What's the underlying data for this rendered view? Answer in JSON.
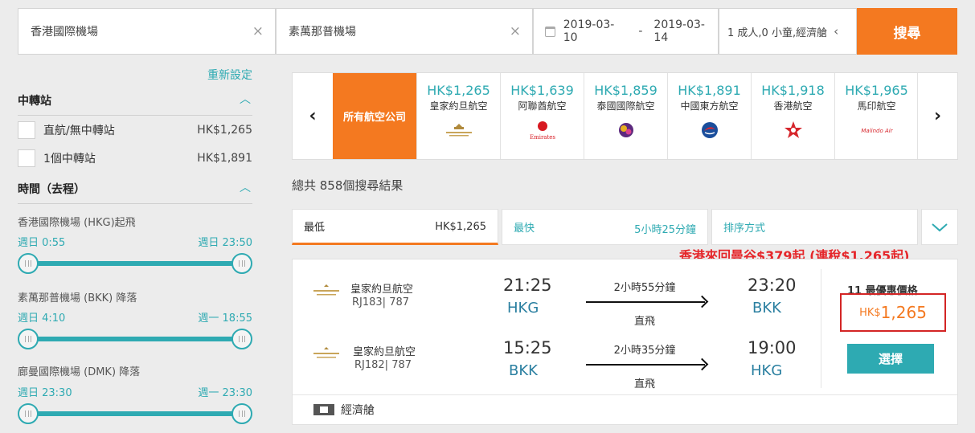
{
  "search": {
    "origin": "香港國際機場",
    "destination": "素萬那普機場",
    "date_from": "2019-03-10",
    "date_sep": "-",
    "date_to": "2019-03-14",
    "passengers": "1 成人,0 小童,經濟艙",
    "search_label": "搜尋",
    "clear_glyph": "×",
    "pax_chevron": "‹"
  },
  "sidebar": {
    "reset_label": "重新設定",
    "stops_title": "中轉站",
    "stops": [
      {
        "label": "直航/無中轉站",
        "price": "HK$1,265"
      },
      {
        "label": "1個中轉站",
        "price": "HK$1,891"
      }
    ],
    "time_title": "時間（去程）",
    "sliders": [
      {
        "label": "香港國際機場 (HKG)起飛",
        "from": "週日 0:55",
        "to": "週日 23:50"
      },
      {
        "label": "素萬那普機場 (BKK) 降落",
        "from": "週日 4:10",
        "to": "週一 18:55"
      },
      {
        "label": "廊曼國際機場 (DMK) 降落",
        "from": "週日 23:30",
        "to": "週一 23:30"
      }
    ]
  },
  "carousel": {
    "all_label": "所有航空公司",
    "items": [
      {
        "price": "HK$1,265",
        "name": "皇家約旦航空",
        "logo": "royal-jordanian-logo"
      },
      {
        "price": "HK$1,639",
        "name": "阿聯酋航空",
        "logo": "emirates-logo"
      },
      {
        "price": "HK$1,859",
        "name": "泰國國際航空",
        "logo": "thai-airways-logo"
      },
      {
        "price": "HK$1,891",
        "name": "中國東方航空",
        "logo": "china-eastern-logo"
      },
      {
        "price": "HK$1,918",
        "name": "香港航空",
        "logo": "hong-kong-airlines-logo"
      },
      {
        "price": "HK$1,965",
        "name": "馬印航空",
        "logo": "malindo-air-logo"
      }
    ],
    "emirates_logo_text": "Emirates",
    "malindo_logo_text": "Malindo Air"
  },
  "results": {
    "total": "總共 858個搜尋結果",
    "tabs": {
      "best_label": "最低",
      "best_value": "HK$1,265",
      "fast_label": "最快",
      "fast_value": "5小時25分鐘",
      "sort_label": "排序方式"
    },
    "promo": "香港來回曼谷$379起 (連稅$1,265起)"
  },
  "card": {
    "legs": [
      {
        "airline": "皇家約旦航空",
        "flight": "RJ183| 787",
        "dep_time": "21:25",
        "dep_airport": "HKG",
        "duration": "2小時55分鐘",
        "stops": "直飛",
        "arr_time": "23:20",
        "arr_airport": "BKK"
      },
      {
        "airline": "皇家約旦航空",
        "flight": "RJ182| 787",
        "dep_time": "15:25",
        "dep_airport": "BKK",
        "duration": "2小時35分鐘",
        "stops": "直飛",
        "arr_time": "19:00",
        "arr_airport": "HKG"
      }
    ],
    "best_label": "11 最優惠價格",
    "price_currency": "HK$",
    "price_amount": "1,265",
    "select_label": "選擇",
    "cabin": "經濟艙"
  },
  "colors": {
    "accent_orange": "#f47920",
    "teal": "#2eaab2",
    "promo_red": "#e5262a"
  }
}
